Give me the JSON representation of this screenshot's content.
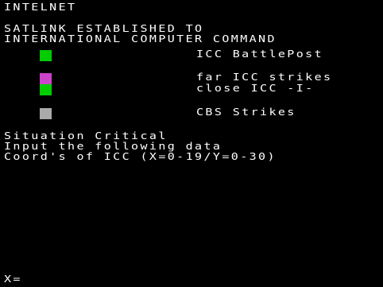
{
  "header": {
    "title": "INTELNET"
  },
  "message": {
    "line1": "SATLINK ESTABLISHED TO",
    "line2": "INTERNATIONAL COMPUTER COMMAND"
  },
  "legend": {
    "battlepost": {
      "label": "ICC BattlePost",
      "color": "#00cc00"
    },
    "far_strikes": {
      "label": "far ICC strikes",
      "color": "#cc44cc"
    },
    "close_icc": {
      "label": "close ICC -I-",
      "color": "#00cc00"
    },
    "cbs_strikes": {
      "label": "CBS Strikes",
      "color": "#aaaaaa"
    }
  },
  "status": {
    "line1": "Situation Critical",
    "line2": "Input the following data",
    "line3": "Coord's of ICC (X=0-19/Y=0-30)"
  },
  "prompt": {
    "label": "X=",
    "value": ""
  },
  "colors": {
    "background": "#000000",
    "text": "#ffffff"
  }
}
